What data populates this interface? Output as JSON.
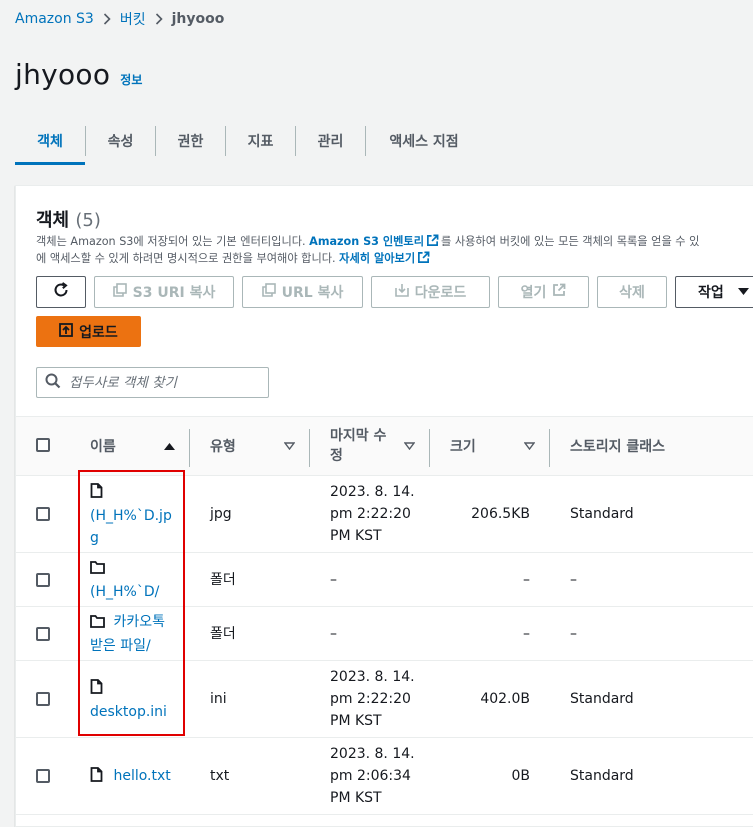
{
  "breadcrumb": {
    "root": "Amazon S3",
    "buckets": "버킷",
    "current": "jhyooo"
  },
  "title": {
    "text": "jhyooo",
    "info": "정보"
  },
  "tabs": [
    {
      "label": "객체"
    },
    {
      "label": "속성"
    },
    {
      "label": "권한"
    },
    {
      "label": "지표"
    },
    {
      "label": "관리"
    },
    {
      "label": "액세스 지점"
    }
  ],
  "objects": {
    "heading": "객체",
    "count": "(5)",
    "desc_part1": "객체는 Amazon S3에 저장되어 있는 기본 엔터티입니다. ",
    "desc_link1": "Amazon S3 인벤토리",
    "desc_part2": "를 사용하여 버킷에 있는 모든 객체의 목록을 얻을 수 있",
    "desc_part3": "에 액세스할 수 있게 하려면 명시적으로 권한을 부여해야 합니다. ",
    "desc_link2": "자세히 알아보기"
  },
  "toolbar": {
    "copy_uri": "S3 URI 복사",
    "copy_url": "URL 복사",
    "download": "다운로드",
    "open": "열기",
    "delete": "삭제",
    "actions": "작업",
    "upload": "업로드"
  },
  "search": {
    "placeholder": "접두사로 객체 찾기"
  },
  "table": {
    "headers": {
      "name": "이름",
      "type": "유형",
      "modified_l1": "마지막 수",
      "modified_l2": "정",
      "size": "크기",
      "storage": "스토리지 클래스"
    },
    "rows": [
      {
        "name_l1": "",
        "name_l2": "(H_H%`D.jp",
        "name_l3": "g",
        "type": "jpg",
        "mod1": "2023. 8. 14.",
        "mod2": "pm 2:22:20",
        "mod3": "PM KST",
        "size": "206.5KB",
        "storage": "Standard",
        "icon": "file-icon"
      },
      {
        "name_l1": "",
        "name_l2": "(H_H%`D/",
        "name_l3": "",
        "type": "폴더",
        "mod1": "",
        "mod2": "–",
        "mod3": "",
        "size": "–",
        "storage": "–",
        "icon": "folder-icon"
      },
      {
        "name_l1": "카카오톡",
        "name_l2": "받은 파일/",
        "name_l3": "",
        "type": "폴더",
        "mod1": "",
        "mod2": "–",
        "mod3": "",
        "size": "–",
        "storage": "–",
        "icon": "folder-icon"
      },
      {
        "name_l1": "",
        "name_l2": "desktop.ini",
        "name_l3": "",
        "type": "ini",
        "mod1": "2023. 8. 14.",
        "mod2": "pm 2:22:20",
        "mod3": "PM KST",
        "size": "402.0B",
        "storage": "Standard",
        "icon": "file-icon"
      },
      {
        "name_l1": "hello.txt",
        "name_l2": "",
        "name_l3": "",
        "type": "txt",
        "mod1": "2023. 8. 14.",
        "mod2": "pm 2:06:34",
        "mod3": "PM KST",
        "size": "0B",
        "storage": "Standard",
        "icon": "file-icon"
      }
    ]
  },
  "colors": {
    "link": "#0073bb",
    "primary": "#ec7211",
    "highlight": "#e00000"
  }
}
